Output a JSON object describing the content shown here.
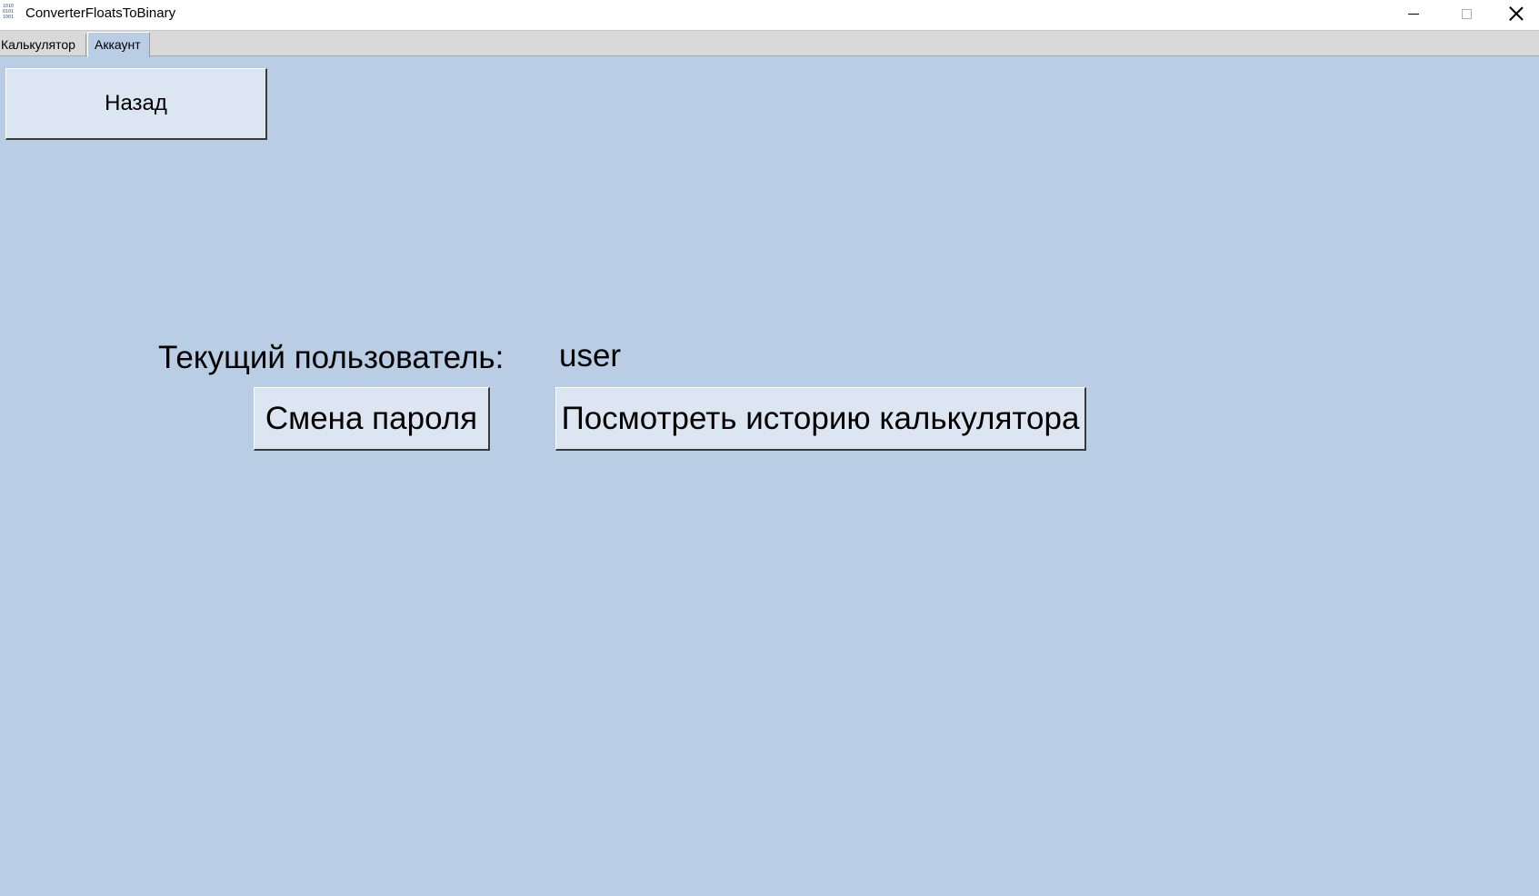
{
  "window": {
    "title": "ConverterFloatsToBinary",
    "icon_glyphs": [
      "1010",
      "0101",
      "1001"
    ]
  },
  "tabs": [
    {
      "label": "Калькулятор",
      "selected": false
    },
    {
      "label": "Аккаунт",
      "selected": true
    }
  ],
  "account": {
    "back_label": "Назад",
    "current_user_label": "Текущий пользователь:",
    "current_user_value": "user",
    "change_password_label": "Смена пароля",
    "view_history_label": "Посмотреть историю калькулятора"
  },
  "colors": {
    "background": "#b9cde5",
    "button_face": "#dce6f2",
    "tabstrip": "#d9d9d9"
  }
}
